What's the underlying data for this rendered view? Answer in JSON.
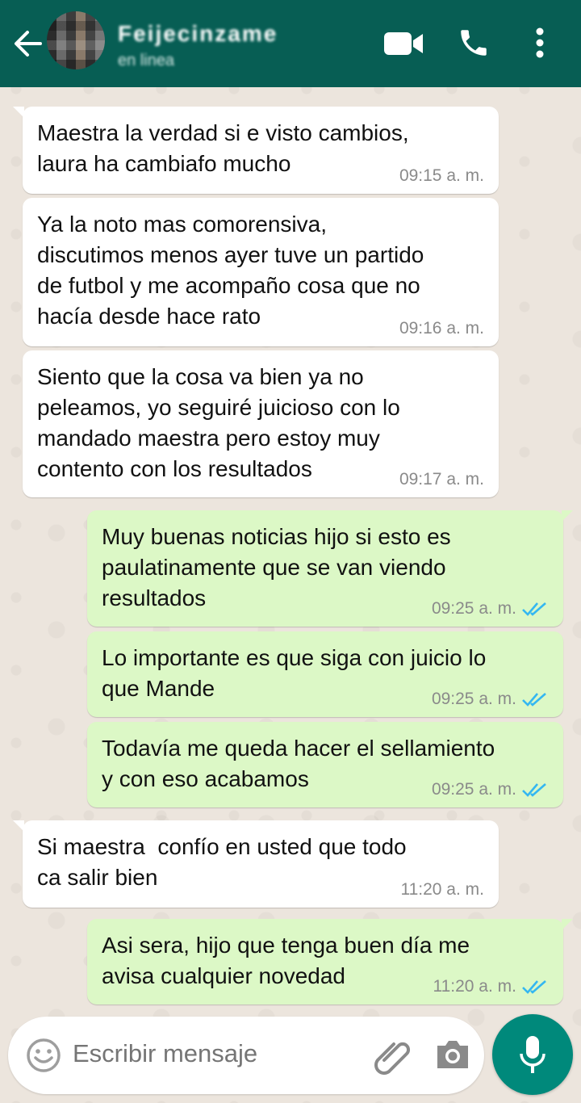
{
  "header": {
    "contact_name": "Feijecinzame",
    "contact_status": "en linea"
  },
  "colors": {
    "header": "#075e54",
    "incoming_bubble": "#ffffff",
    "outgoing_bubble": "#dcf8c6",
    "chat_background": "#ece5dd",
    "mic_button": "#00897b",
    "read_ticks": "#34b7f1"
  },
  "icons": {
    "back": "arrow-left-icon",
    "video": "video-camera-icon",
    "call": "phone-icon",
    "more": "more-vertical-icon",
    "emoji": "emoji-icon",
    "attach": "paperclip-icon",
    "camera": "camera-icon",
    "mic": "microphone-icon"
  },
  "messages": [
    {
      "dir": "in",
      "text": "Maestra la verdad si e visto cambios,\nlaura ha cambiafo mucho",
      "time": "09:15 a. m."
    },
    {
      "dir": "in",
      "text": "Ya la noto mas comorensiva,\ndiscutimos menos ayer tuve un partido\nde futbol y me acompaño cosa que no\nhacía desde hace rato",
      "time": "09:16 a. m."
    },
    {
      "dir": "in",
      "text": "Siento que la cosa va bien ya no\npeleamos, yo seguiré juicioso con lo\nmandado maestra pero estoy muy\ncontento con los resultados",
      "time": "09:17 a. m."
    },
    {
      "dir": "out",
      "text": "Muy buenas noticias hijo si esto es\npaulatinamente que se van viendo\nresultados",
      "time": "09:25 a. m."
    },
    {
      "dir": "out",
      "text": "Lo importante es que siga con juicio lo\nque Mande",
      "time": "09:25 a. m."
    },
    {
      "dir": "out",
      "text": "Todavía me queda hacer el sellamiento\ny con eso acabamos",
      "time": "09:25 a. m."
    },
    {
      "dir": "in",
      "text": "Si maestra  confío en usted que todo\nca salir bien",
      "time": "11:20 a. m."
    },
    {
      "dir": "out",
      "text": "Asi sera, hijo que tenga buen día me\navisa cualquier novedad",
      "time": "11:20 a. m."
    }
  ],
  "composer": {
    "placeholder": "Escribir mensaje"
  }
}
